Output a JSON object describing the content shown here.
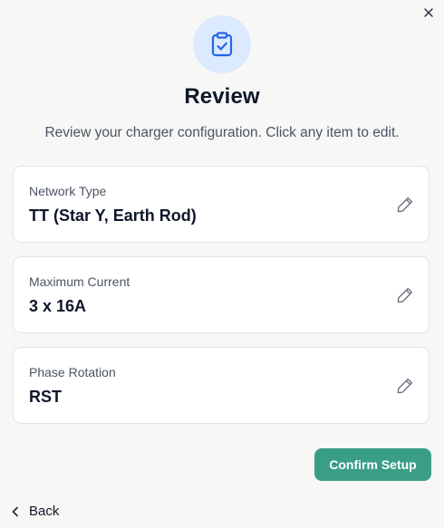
{
  "dialog": {
    "title": "Review",
    "subtitle": "Review your charger configuration. Click any item to edit.",
    "hero_icon": "clipboard-check-icon",
    "close_icon": "close-icon"
  },
  "items": [
    {
      "label": "Network Type",
      "value": "TT (Star Y, Earth Rod)",
      "edit_icon": "pencil-icon"
    },
    {
      "label": "Maximum Current",
      "value": "3 x 16A",
      "edit_icon": "pencil-icon"
    },
    {
      "label": "Phase Rotation",
      "value": "RST",
      "edit_icon": "pencil-icon"
    }
  ],
  "actions": {
    "confirm_label": "Confirm Setup",
    "back_label": "Back"
  },
  "colors": {
    "accent": "#3a9e87",
    "hero_bg": "#dbeafe",
    "hero_icon": "#2563eb",
    "background": "#f7f7f5",
    "card_border": "#e2e4e8"
  }
}
